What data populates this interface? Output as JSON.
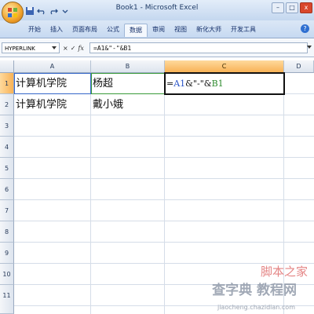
{
  "window": {
    "title": "Book1 - Microsoft Excel",
    "minimize": "–",
    "restore": "□",
    "close": "x"
  },
  "ribbon": {
    "tabs": [
      {
        "label": "开始"
      },
      {
        "label": "插入"
      },
      {
        "label": "页面布局"
      },
      {
        "label": "公式"
      },
      {
        "label": "数据"
      },
      {
        "label": "审阅"
      },
      {
        "label": "视图"
      },
      {
        "label": "新化大师"
      },
      {
        "label": "开发工具"
      }
    ],
    "active_tab": "数据",
    "help": "?"
  },
  "formula_bar": {
    "name_box": "HYPERLINK",
    "cancel": "×",
    "enter": "✓",
    "fx": "fx",
    "formula": "=A1&\"-\"&B1"
  },
  "sheet": {
    "columns": [
      "A",
      "B",
      "C",
      "D"
    ],
    "rows": [
      "1",
      "2",
      "3",
      "4",
      "5",
      "6",
      "7",
      "8",
      "9",
      "10",
      "11"
    ],
    "selected_column": "C",
    "selected_row": "1",
    "cells": {
      "A1": "计算机学院",
      "B1": "杨超",
      "A2": "计算机学院",
      "B2": "戴小娥",
      "C1_prefix": "=",
      "C1_ref_a": "A1",
      "C1_mid": "&\"-\"&",
      "C1_ref_b": "B1"
    }
  },
  "watermark": {
    "line1": "脚本之家",
    "line2": "查字典 教程网",
    "line3": "jiaocheng.chazidian.com"
  },
  "colors": {
    "ref_a": "#2a55c8",
    "ref_b": "#2e8b2e",
    "selected_header": "#f8b256"
  }
}
